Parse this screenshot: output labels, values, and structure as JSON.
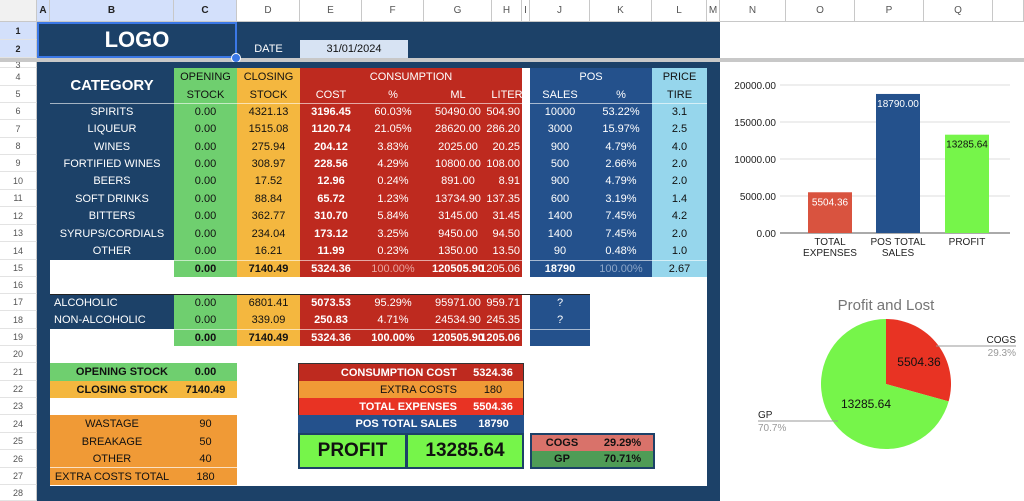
{
  "sheet": {
    "columns": [
      "A",
      "B",
      "C",
      "D",
      "E",
      "F",
      "G",
      "H",
      "I",
      "J",
      "K",
      "L",
      "M",
      "N",
      "O",
      "P",
      "Q"
    ],
    "rows": [
      "1",
      "2",
      "3",
      "4",
      "5",
      "6",
      "7",
      "8",
      "9",
      "10",
      "11",
      "12",
      "13",
      "14",
      "15",
      "16",
      "17",
      "18",
      "19",
      "20",
      "21",
      "22",
      "23",
      "24",
      "25",
      "26",
      "27",
      "28"
    ]
  },
  "header": {
    "logo": "LOGO",
    "date_label": "DATE",
    "date_value": "31/01/2024"
  },
  "table": {
    "category_header": "CATEGORY",
    "opening_header": [
      "OPENING",
      "STOCK"
    ],
    "closing_header": [
      "CLOSING",
      "STOCK"
    ],
    "consumption_header": "CONSUMPTION",
    "consumption_sub": [
      "COST",
      "%",
      "ML",
      "LITER"
    ],
    "pos_header": "POS",
    "pos_sub": [
      "SALES",
      "%"
    ],
    "price_header": [
      "PRICE",
      "TIRE"
    ],
    "rows": [
      {
        "category": "SPIRITS",
        "opening": "0.00",
        "closing": "4321.13",
        "cost": "3196.45",
        "pct": "60.03%",
        "ml": "50490.00",
        "liter": "504.90",
        "sales": "10000",
        "sales_pct": "53.22%",
        "price": "3.1"
      },
      {
        "category": "LIQUEUR",
        "opening": "0.00",
        "closing": "1515.08",
        "cost": "1120.74",
        "pct": "21.05%",
        "ml": "28620.00",
        "liter": "286.20",
        "sales": "3000",
        "sales_pct": "15.97%",
        "price": "2.5"
      },
      {
        "category": "WINES",
        "opening": "0.00",
        "closing": "275.94",
        "cost": "204.12",
        "pct": "3.83%",
        "ml": "2025.00",
        "liter": "20.25",
        "sales": "900",
        "sales_pct": "4.79%",
        "price": "4.0"
      },
      {
        "category": "FORTIFIED WINES",
        "opening": "0.00",
        "closing": "308.97",
        "cost": "228.56",
        "pct": "4.29%",
        "ml": "10800.00",
        "liter": "108.00",
        "sales": "500",
        "sales_pct": "2.66%",
        "price": "2.0"
      },
      {
        "category": "BEERS",
        "opening": "0.00",
        "closing": "17.52",
        "cost": "12.96",
        "pct": "0.24%",
        "ml": "891.00",
        "liter": "8.91",
        "sales": "900",
        "sales_pct": "4.79%",
        "price": "2.0"
      },
      {
        "category": "SOFT DRINKS",
        "opening": "0.00",
        "closing": "88.84",
        "cost": "65.72",
        "pct": "1.23%",
        "ml": "13734.90",
        "liter": "137.35",
        "sales": "600",
        "sales_pct": "3.19%",
        "price": "1.4"
      },
      {
        "category": "BITTERS",
        "opening": "0.00",
        "closing": "362.77",
        "cost": "310.70",
        "pct": "5.84%",
        "ml": "3145.00",
        "liter": "31.45",
        "sales": "1400",
        "sales_pct": "7.45%",
        "price": "4.2"
      },
      {
        "category": "SYRUPS/CORDIALS",
        "opening": "0.00",
        "closing": "234.04",
        "cost": "173.12",
        "pct": "3.25%",
        "ml": "9450.00",
        "liter": "94.50",
        "sales": "1400",
        "sales_pct": "7.45%",
        "price": "2.0"
      },
      {
        "category": "OTHER",
        "opening": "0.00",
        "closing": "16.21",
        "cost": "11.99",
        "pct": "0.23%",
        "ml": "1350.00",
        "liter": "13.50",
        "sales": "90",
        "sales_pct": "0.48%",
        "price": "1.0"
      }
    ],
    "totals": {
      "opening": "0.00",
      "closing": "7140.49",
      "cost": "5324.36",
      "pct": "100.00%",
      "ml": "120505.90",
      "liter": "1205.06",
      "sales": "18790",
      "sales_pct": "100.00%",
      "price": "2.67"
    }
  },
  "split": {
    "rows": [
      {
        "category": "ALCOHOLIC",
        "opening": "0.00",
        "closing": "6801.41",
        "cost": "5073.53",
        "pct": "95.29%",
        "ml": "95971.00",
        "liter": "959.71",
        "sales": "?"
      },
      {
        "category": "NON-ALCOHOLIC",
        "opening": "0.00",
        "closing": "339.09",
        "cost": "250.83",
        "pct": "4.71%",
        "ml": "24534.90",
        "liter": "245.35",
        "sales": "?"
      }
    ],
    "totals": {
      "opening": "0.00",
      "closing": "7140.49",
      "cost": "5324.36",
      "pct": "100.00%",
      "ml": "120505.90",
      "liter": "1205.06",
      "sales": ""
    }
  },
  "stock_summary": {
    "opening_label": "OPENING STOCK",
    "opening_value": "0.00",
    "closing_label": "CLOSING STOCK",
    "closing_value": "7140.49"
  },
  "extra_costs": {
    "items": [
      {
        "label": "WASTAGE",
        "value": "90"
      },
      {
        "label": "BREAKAGE",
        "value": "50"
      },
      {
        "label": "OTHER",
        "value": "40"
      }
    ],
    "total_label": "EXTRA COSTS TOTAL",
    "total_value": "180"
  },
  "summary": {
    "consumption_cost_label": "CONSUMPTION COST",
    "consumption_cost_value": "5324.36",
    "extra_costs_label": "EXTRA COSTS",
    "extra_costs_value": "180",
    "total_expenses_label": "TOTAL EXPENSES",
    "total_expenses_value": "5504.36",
    "pos_total_label": "POS TOTAL SALES",
    "pos_total_value": "18790",
    "profit_label": "PROFIT",
    "profit_value": "13285.64"
  },
  "ratios": {
    "cogs_label": "COGS",
    "cogs_value": "29.29%",
    "gp_label": "GP",
    "gp_value": "70.71%"
  },
  "colors": {
    "navy": "#1c4168",
    "pos_blue": "#24518c",
    "green": "#6fcf6f",
    "amber": "#f4b73f",
    "red": "#be2a1f",
    "light_blue": "#96d6ec",
    "orange": "#f09a36",
    "bright_red": "#e83323",
    "lime": "#76f54a"
  },
  "chart_data": [
    {
      "type": "bar",
      "title": "",
      "categories": [
        [
          "TOTAL",
          "EXPENSES"
        ],
        [
          "POS TOTAL",
          "SALES"
        ],
        [
          "PROFIT"
        ]
      ],
      "values": [
        5504.36,
        18790.0,
        13285.64
      ],
      "data_labels": [
        "5504.36",
        "18790.00",
        "13285.64"
      ],
      "colors": [
        "#d9533f",
        "#24518c",
        "#76f54a"
      ],
      "label_colors": [
        "#ffffff",
        "#ffffff",
        "#111111"
      ],
      "ylim": [
        0,
        20000
      ],
      "yticks": [
        "0.00",
        "5000.00",
        "10000.00",
        "15000.00",
        "20000.00"
      ],
      "ytick_values": [
        0,
        5000,
        10000,
        15000,
        20000
      ],
      "grid": true,
      "xlabel": "",
      "ylabel": ""
    },
    {
      "type": "pie",
      "title": "Profit and Lost",
      "slices": [
        {
          "label": "COGS",
          "value": 5504.36,
          "percent": "29.3%",
          "color": "#e83323",
          "data_label": "5504.36"
        },
        {
          "label": "GP",
          "value": 13285.64,
          "percent": "70.7%",
          "color": "#76f54a",
          "data_label": "13285.64"
        }
      ],
      "legend": "labels-with-leader-lines"
    }
  ]
}
